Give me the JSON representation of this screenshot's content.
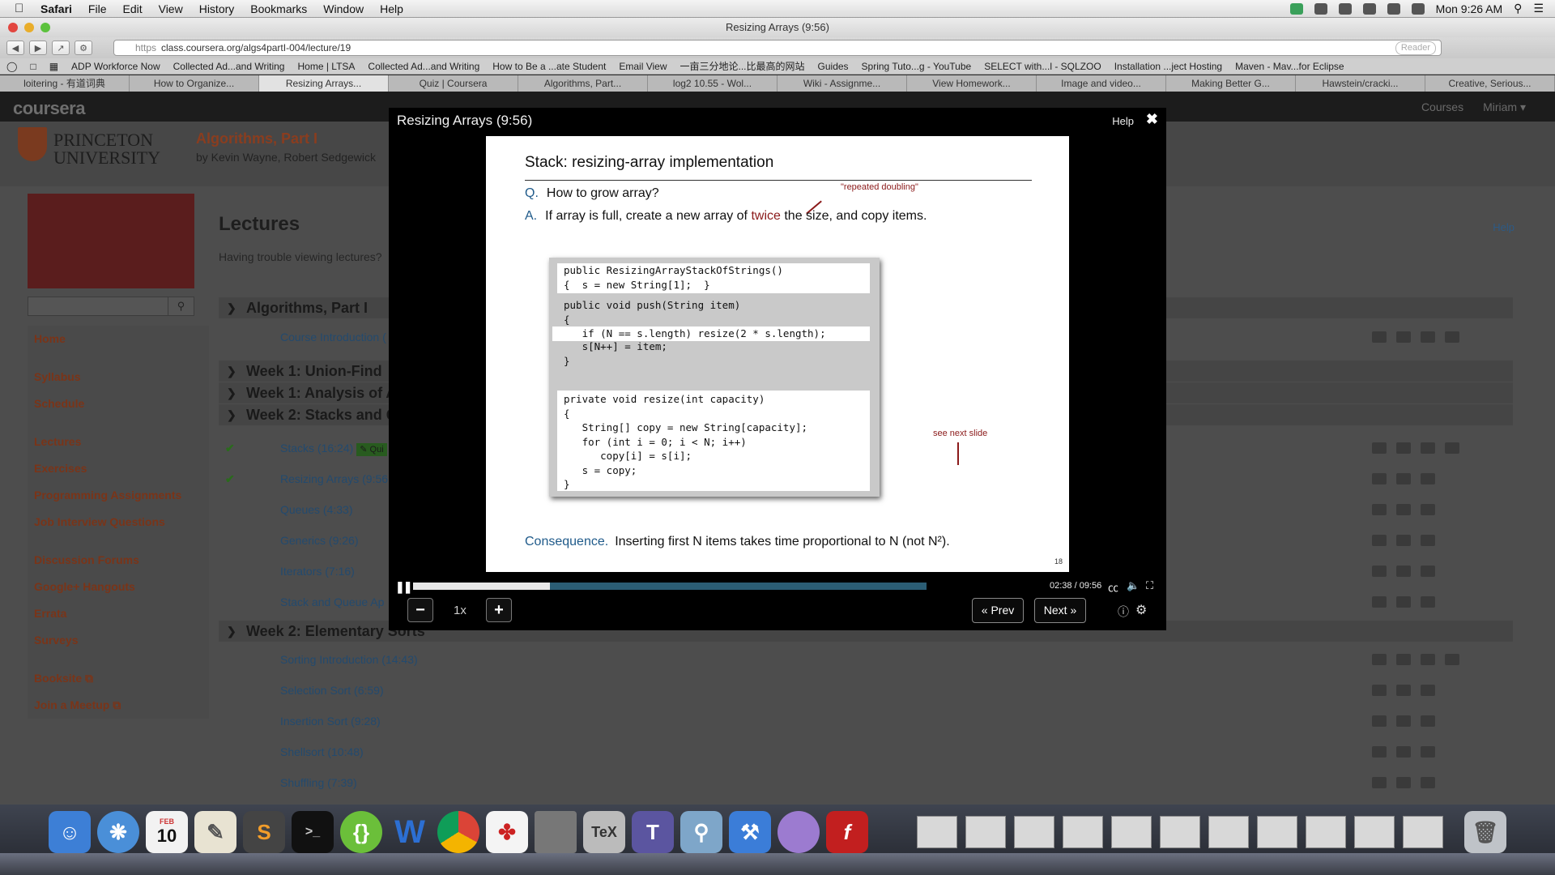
{
  "menubar": {
    "app": "Safari",
    "items": [
      "File",
      "Edit",
      "View",
      "History",
      "Bookmarks",
      "Window",
      "Help"
    ],
    "clock": "Mon 9:26 AM"
  },
  "window": {
    "title": "Resizing Arrays (9:56)"
  },
  "address": {
    "scheme": "https",
    "url": "class.coursera.org/algs4partI-004/lecture/19",
    "reader": "Reader"
  },
  "bookmarks": [
    "ADP Workforce Now",
    "Collected Ad...and Writing",
    "Home | LTSA",
    "Collected Ad...and Writing",
    "How to Be a ...ate Student",
    "Email View",
    "一亩三分地论...比最高的网站",
    "Guides",
    "Spring Tuto...g - YouTube",
    "SELECT with...l - SQLZOO",
    "Installation ...ject Hosting",
    "Maven - Mav...for Eclipse"
  ],
  "tabs": [
    "loitering - 有道词典",
    "How to Organize...",
    "Resizing Arrays...",
    "Quiz | Coursera",
    "Algorithms, Part...",
    "log2 10.55 - Wol...",
    "Wiki - Assignme...",
    "View Homework...",
    "Image and video...",
    "Making Better G...",
    "Hawstein/cracki...",
    "Creative, Serious..."
  ],
  "active_tab": 2,
  "site": {
    "logo": "coursera",
    "nav_right": [
      "Courses",
      "Miriam ▾"
    ],
    "university_line1": "PRINCETON",
    "university_line2": "UNIVERSITY",
    "course_title": "Algorithms, Part I",
    "course_by": "by Kevin Wayne, Robert Sedgewick"
  },
  "sidebar": {
    "groups": [
      [
        "Home"
      ],
      [
        "Syllabus",
        "Schedule"
      ],
      [
        "Lectures",
        "Exercises",
        "Programming Assignments",
        "Job Interview Questions"
      ],
      [
        "Discussion Forums",
        "Google+ Hangouts",
        "Errata",
        "Surveys"
      ],
      [
        "Booksite ⧉",
        "Join a Meetup ⧉"
      ]
    ]
  },
  "main": {
    "heading": "Lectures",
    "trouble": "Having trouble viewing lectures?",
    "help": "Help"
  },
  "sections": [
    {
      "title": "Algorithms, Part I",
      "open": true
    },
    {
      "title": "Week 1: Union-Find",
      "open": false
    },
    {
      "title": "Week 1: Analysis of A",
      "open": false
    },
    {
      "title": "Week 2: Stacks and Q",
      "open": true
    },
    {
      "title": "Week 2: Elementary Sorts",
      "open": true
    }
  ],
  "lectures": [
    {
      "title": "Course Introduction (",
      "done": false
    },
    {
      "title": "Stacks (16:24)",
      "done": true,
      "quiz": "✎ Qui"
    },
    {
      "title": "Resizing Arrays (9:56",
      "done": true
    },
    {
      "title": "Queues (4:33)",
      "done": false
    },
    {
      "title": "Generics (9:26)",
      "done": false
    },
    {
      "title": "Iterators (7:16)",
      "done": false
    },
    {
      "title": "Stack and Queue Ap",
      "done": false
    },
    {
      "title": "Sorting Introduction (14:43)",
      "done": false
    },
    {
      "title": "Selection Sort (6:59)",
      "done": false
    },
    {
      "title": "Insertion Sort (9:28)",
      "done": false
    },
    {
      "title": "Shellsort (10:48)",
      "done": false
    },
    {
      "title": "Shuffling (7:39)",
      "done": false
    }
  ],
  "player": {
    "title": "Resizing Arrays (9:56)",
    "help": "Help",
    "time": "02:38 / 09:56",
    "played_fraction": 0.266,
    "buffered_fraction": 0.266,
    "rate": "1x",
    "prev": "« Prev",
    "next": "Next »"
  },
  "slide": {
    "title": "Stack:  resizing-array implementation",
    "q_label": "Q.",
    "q_text": "How to grow array?",
    "a_label": "A.",
    "a_text_1": "If array is full, create a new array of",
    "a_twice": "twice",
    "a_text_2": "the size, and copy items.",
    "note_doubling": "\"repeated doubling\"",
    "note_next": "see next slide",
    "code_ctor": "public ResizingArrayStackOfStrings()\n{  s = new String[1];  }",
    "code_push_head": "public void push(String item)\n{",
    "code_push_if": "   if (N == s.length) resize(2 * s.length);",
    "code_push_tail": "   s[N++] = item;\n}",
    "code_resize": "private void resize(int capacity)\n{\n   String[] copy = new String[capacity];\n   for (int i = 0; i < N; i++)\n      copy[i] = s[i];\n   s = copy;\n}",
    "cons_label": "Consequence.",
    "cons_text": "Inserting first N items takes time proportional to N (not N²).",
    "page_number": "18"
  },
  "dock": [
    "Finder",
    "Safari",
    "Calendar 10",
    "TextEdit",
    "Sublime Text",
    "Terminal",
    "Brackets",
    "Word",
    "Chrome",
    "Acrobat",
    "Screen",
    "LaTeXiT",
    "TextMate",
    "Preview",
    "Xcode",
    "Instruments",
    "Flash",
    "Trash"
  ],
  "dock_calendar": {
    "month": "FEB",
    "day": "10"
  }
}
